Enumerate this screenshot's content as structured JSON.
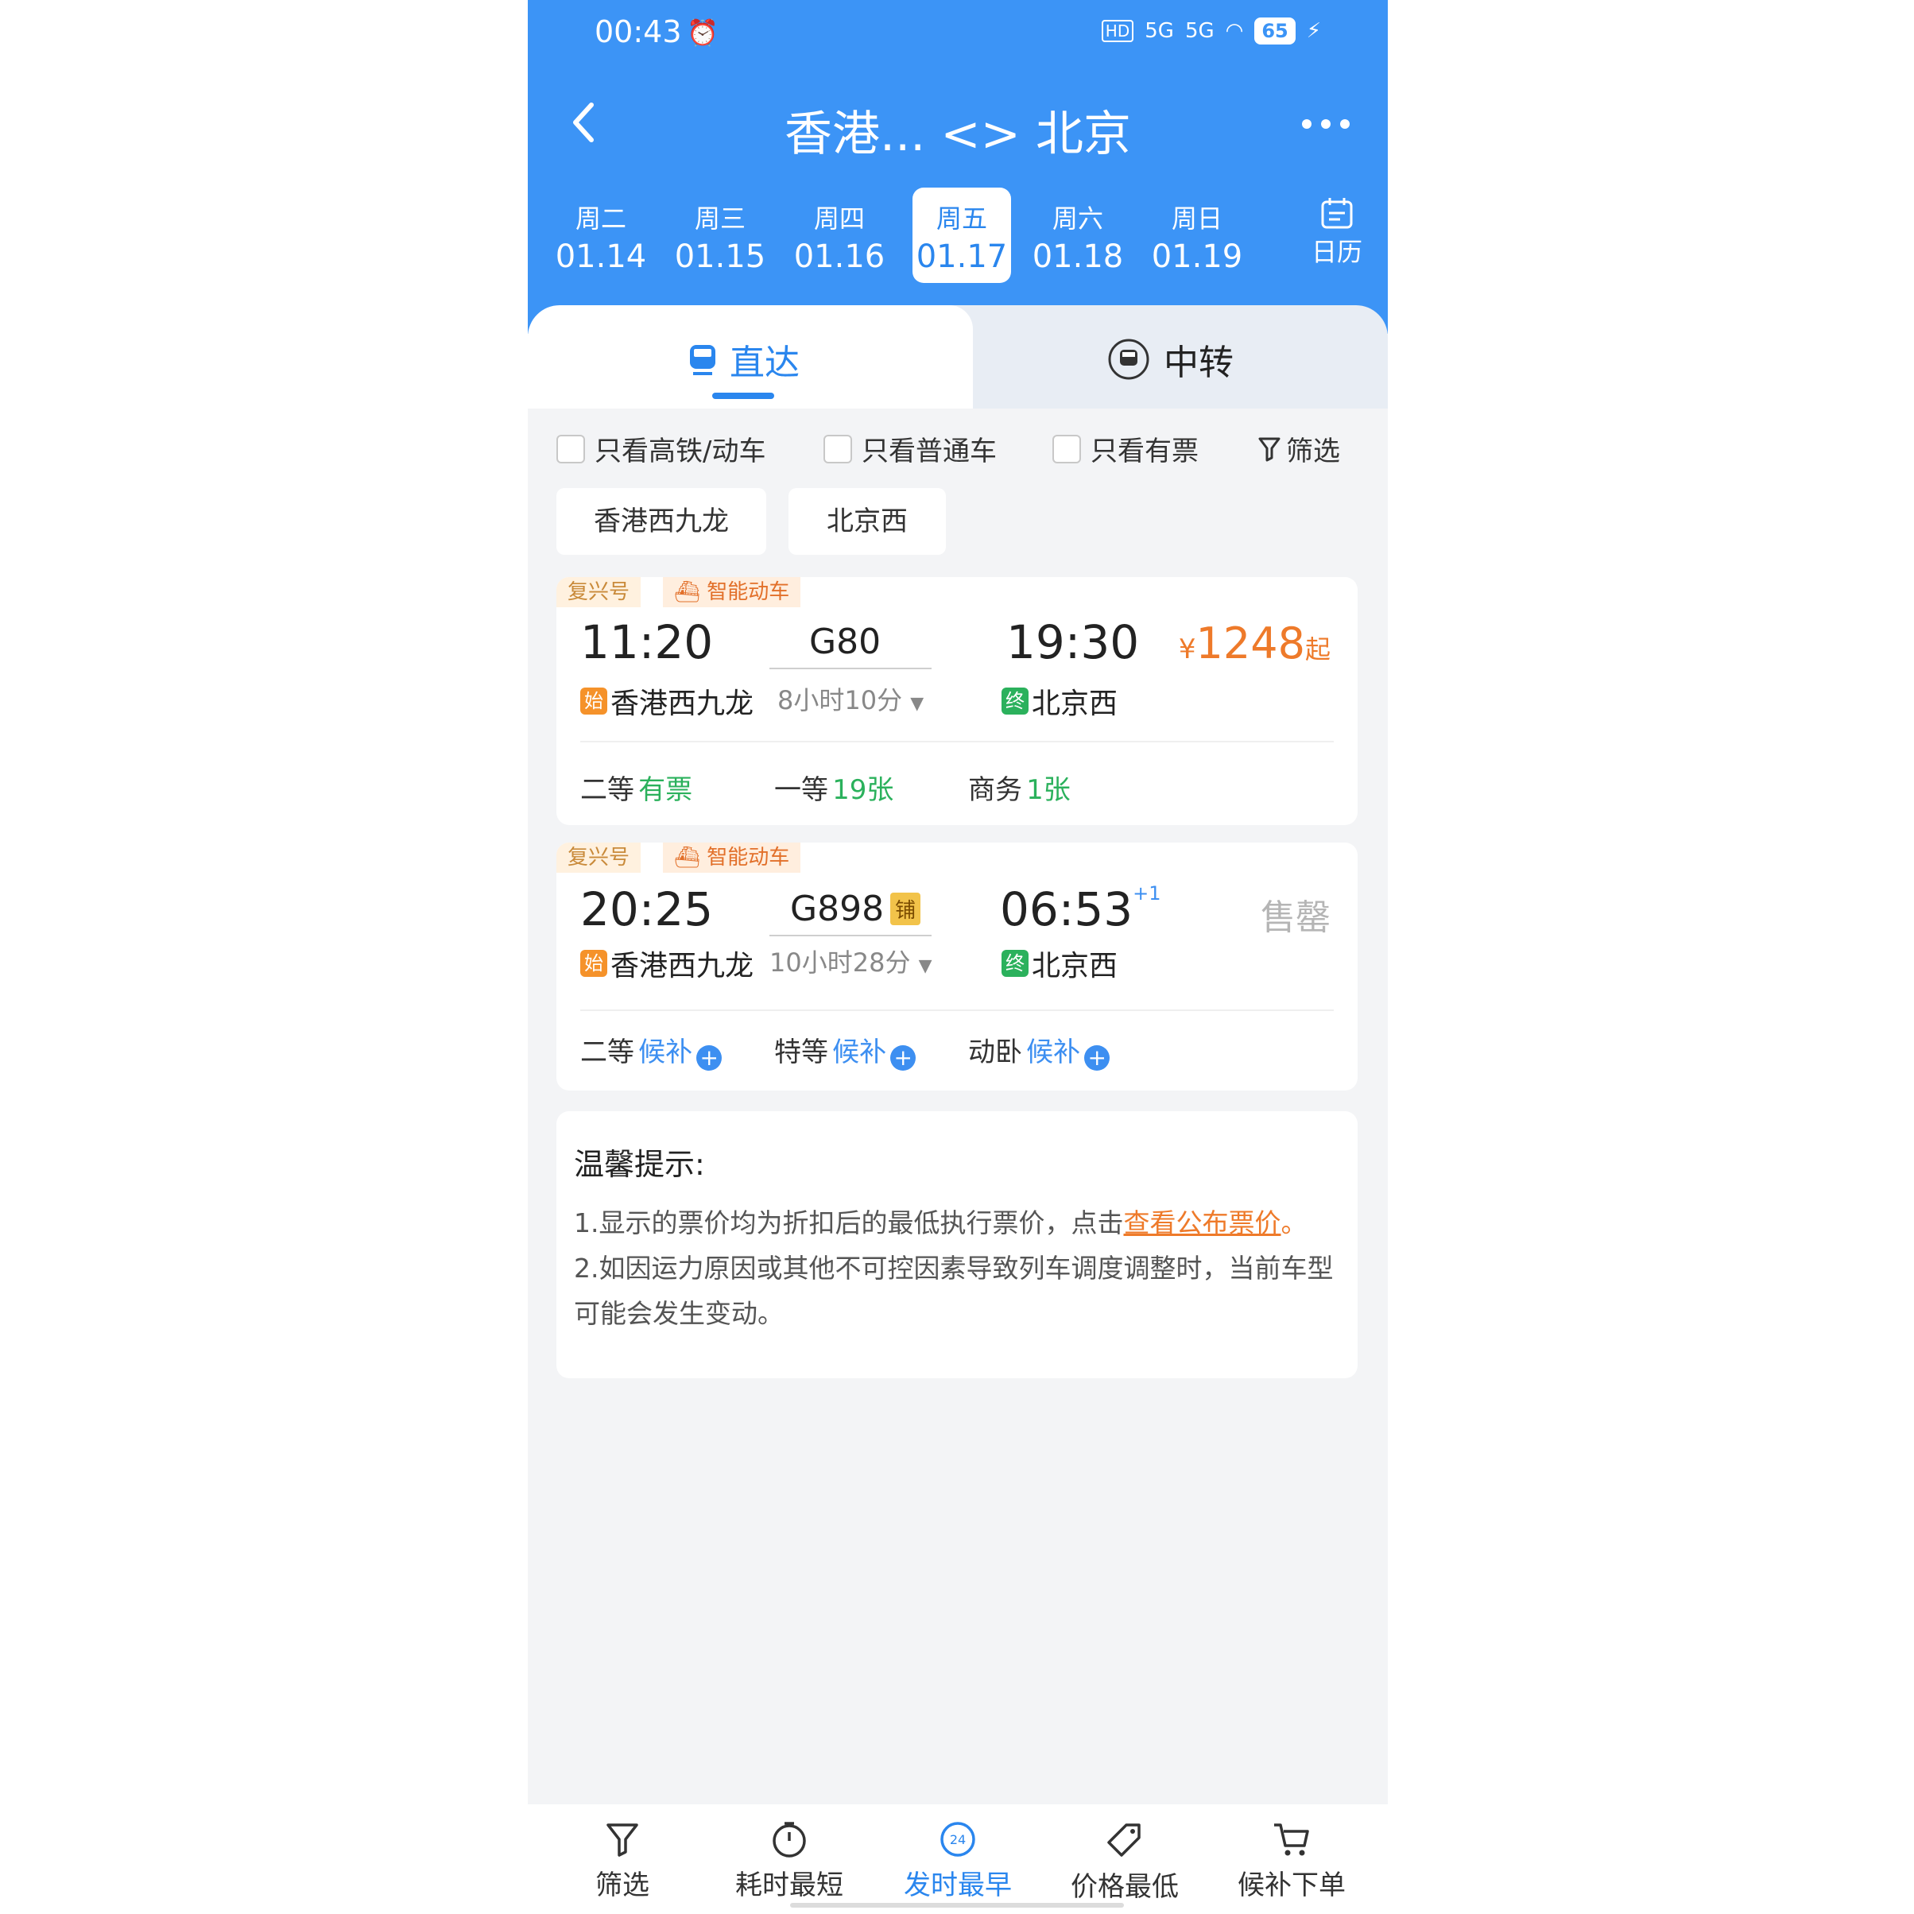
{
  "status": {
    "time": "00:43",
    "battery": "65",
    "network": "5G"
  },
  "header": {
    "title": "香港... <> 北京"
  },
  "dates": [
    {
      "weekday": "周二",
      "date": "01.14"
    },
    {
      "weekday": "周三",
      "date": "01.15"
    },
    {
      "weekday": "周四",
      "date": "01.16"
    },
    {
      "weekday": "周五",
      "date": "01.17"
    },
    {
      "weekday": "周六",
      "date": "01.18"
    },
    {
      "weekday": "周日",
      "date": "01.19"
    }
  ],
  "calendar_label": "日历",
  "tabs": {
    "direct": "直达",
    "transfer": "中转"
  },
  "filters": {
    "highspeed": "只看高铁/动车",
    "normal": "只看普通车",
    "available": "只看有票",
    "filter": "筛选"
  },
  "stations": {
    "from": "香港西九龙",
    "to": "北京西"
  },
  "trains": [
    {
      "tags": [
        "复兴号",
        "智能动车"
      ],
      "depart": "11:20",
      "train_no": "G80",
      "arrive": "19:30",
      "arrive_suffix": "",
      "duration": "8小时10分",
      "from": "香港西九龙",
      "to": "北京西",
      "from_icon": "始",
      "to_icon": "终",
      "price_symbol": "¥",
      "price": "1248",
      "price_suffix": "起",
      "seats": [
        {
          "name": "二等",
          "status": "有票"
        },
        {
          "name": "一等",
          "status": "19张"
        },
        {
          "name": "商务",
          "status": "1张"
        }
      ]
    },
    {
      "tags": [
        "复兴号",
        "智能动车"
      ],
      "depart": "20:25",
      "train_no": "G898",
      "sleeper_badge": "铺",
      "arrive": "06:53",
      "arrive_suffix": "+1",
      "duration": "10小时28分",
      "from": "香港西九龙",
      "to": "北京西",
      "from_icon": "始",
      "to_icon": "终",
      "status": "售罄",
      "seats": [
        {
          "name": "二等",
          "status": "候补"
        },
        {
          "name": "特等",
          "status": "候补"
        },
        {
          "name": "动卧",
          "status": "候补"
        }
      ]
    }
  ],
  "tips": {
    "title": "温馨提示:",
    "line1_pre": "1.显示的票价均为折扣后的最低执行票价，点击",
    "line1_link": "查看公布票价",
    "line1_post": "。",
    "line2": "2.如因运力原因或其他不可控因素导致列车调度调整时，当前车型可能会发生变动。"
  },
  "bottom_nav": [
    "筛选",
    "耗时最短",
    "发时最早",
    "价格最低",
    "候补下单"
  ],
  "colors": {
    "primary": "#3c94f6",
    "green": "#2bb15c",
    "orange": "#ee7a2a"
  }
}
